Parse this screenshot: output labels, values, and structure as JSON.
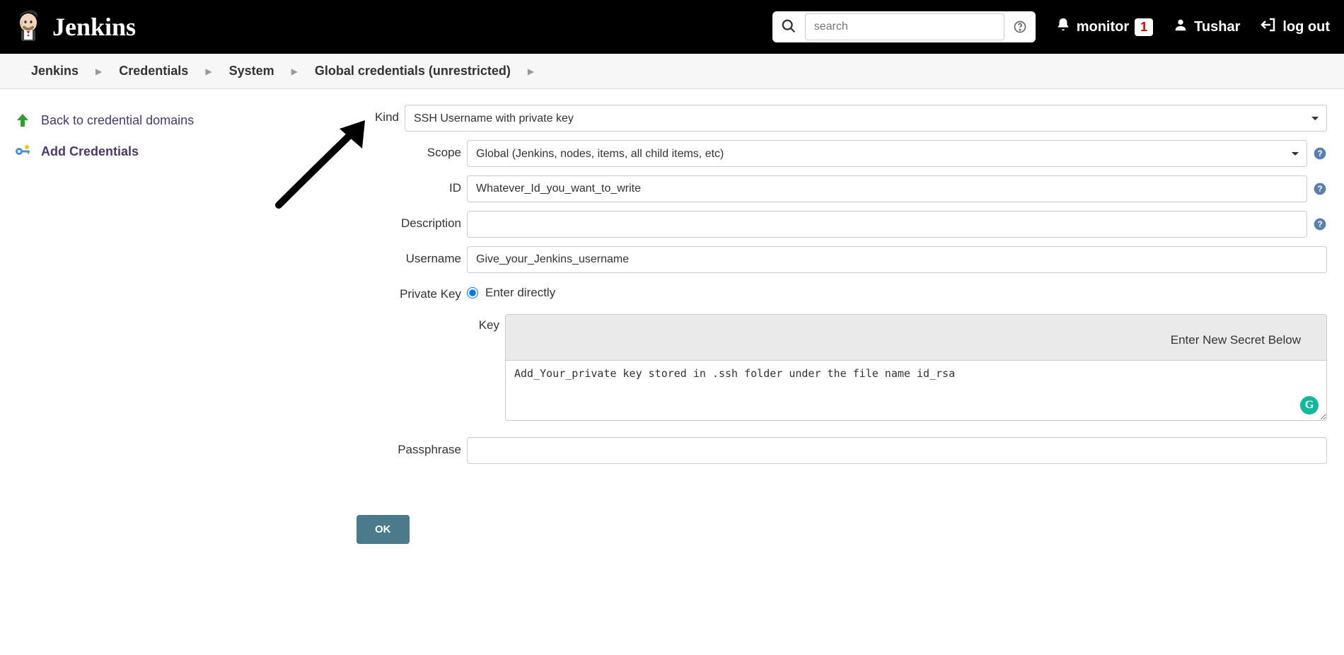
{
  "header": {
    "app_title": "Jenkins",
    "search_placeholder": "search",
    "monitor_label": "monitor",
    "monitor_count": "1",
    "user_name": "Tushar",
    "logout_label": "log out"
  },
  "breadcrumbs": [
    "Jenkins",
    "Credentials",
    "System",
    "Global credentials (unrestricted)"
  ],
  "sidebar": {
    "back_label": "Back to credential domains",
    "add_label": "Add Credentials"
  },
  "form": {
    "labels": {
      "kind": "Kind",
      "scope": "Scope",
      "id": "ID",
      "description": "Description",
      "username": "Username",
      "private_key": "Private Key",
      "enter_directly": "Enter directly",
      "key": "Key",
      "secret_header": "Enter New Secret Below",
      "passphrase": "Passphrase",
      "ok": "OK"
    },
    "values": {
      "kind": "SSH Username with private key",
      "scope": "Global (Jenkins, nodes, items, all child items, etc)",
      "id": "Whatever_Id_you_want_to_write",
      "description": "",
      "username": "Give_your_Jenkins_username",
      "key_textarea": "Add_Your_private key stored in .ssh folder under the file name id_rsa",
      "passphrase": ""
    }
  },
  "icons": {
    "grammarly": "G"
  }
}
